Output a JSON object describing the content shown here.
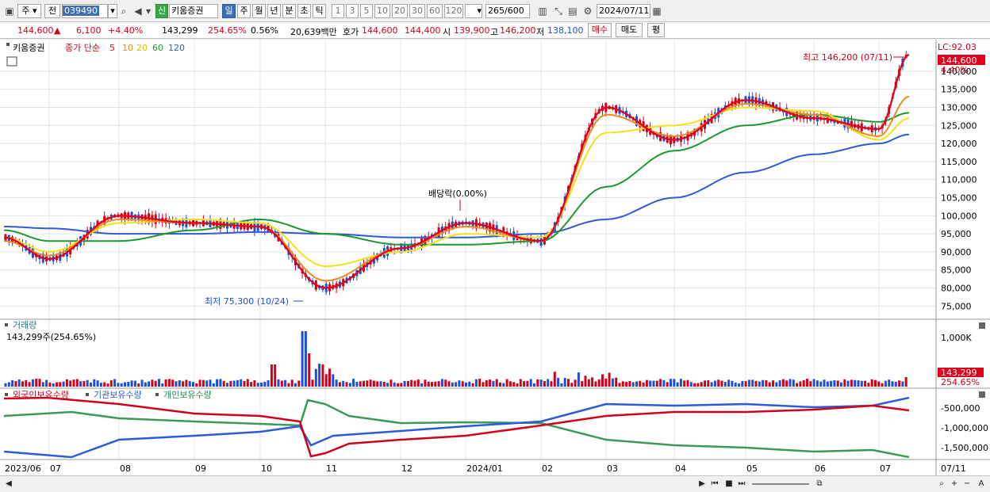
{
  "toolbar": {
    "market": "주",
    "market_all": "전",
    "code": "039490",
    "sin_badge": "신",
    "stock_name": "키움증권",
    "periods": [
      "일",
      "주",
      "월",
      "년",
      "분",
      "초",
      "틱"
    ],
    "active_period": "일",
    "intervals": [
      "1",
      "3",
      "5",
      "10",
      "20",
      "30",
      "60",
      "120"
    ],
    "count": "265",
    "count_total": "/600",
    "date": "2024/07/11"
  },
  "quote": {
    "price": "144,600",
    "direction": "▲",
    "change": "6,100",
    "change_pct": "+4.40%",
    "volume": "143,299",
    "volume_ratio": "254.65%",
    "turnover": "0.56%",
    "amount": "20,639백만",
    "ask_label": "호가",
    "ask": "144,600",
    "bid": "144,400",
    "open_label": "시",
    "open": "139,900",
    "high_label": "고",
    "high": "146,200",
    "low_label": "저",
    "low": "138,100",
    "buy_label": "매수",
    "sell_label": "매도",
    "eval_label": "평"
  },
  "legend": {
    "name": "키움증권",
    "ma_label": "종가 단순",
    "ma_periods": [
      "5",
      "10",
      "20",
      "60",
      "120"
    ]
  },
  "annotations": {
    "high_note": "최고 146,200 (07/11)",
    "low_note": "최저 75,300 (10/24)",
    "dividend_note": "배당락(0.00%)",
    "lc": "LC:92.03",
    "last_price": "144,600",
    "last_pct": "4.40%"
  },
  "volume_panel": {
    "title": "거래량",
    "info": "143,299주(254.65%)",
    "tick": "1,000K",
    "last_value": "143,299",
    "last_pct": "254.65%"
  },
  "holdings_panel": {
    "series_labels": [
      "외국인보유수량",
      "기관보유수량",
      "개인보유수량"
    ],
    "ticks": [
      "-500,000",
      "-1,000,000",
      "-1,500,000"
    ]
  },
  "xaxis": {
    "labels": [
      "2023/06",
      "07",
      "08",
      "09",
      "10",
      "11",
      "12",
      "2024/01",
      "02",
      "03",
      "04",
      "05",
      "06",
      "07"
    ],
    "right_label": "07/11"
  },
  "colors": {
    "up": "#d0021b",
    "down": "#1e4fd8",
    "ma5": "#e0001b",
    "ma10": "#f08a1c",
    "ma20": "#f2e21a",
    "ma60": "#1a9a2e",
    "ma120": "#2e5bd8",
    "foreign": "#d0021b",
    "institution": "#2e5bd8",
    "individual": "#3a9a5a"
  },
  "chart_data": {
    "type": "line",
    "title": "키움증권",
    "y_ticks": [
      75000,
      80000,
      85000,
      90000,
      95000,
      100000,
      105000,
      110000,
      115000,
      120000,
      125000,
      130000,
      135000,
      140000
    ],
    "ylim": [
      72000,
      147000
    ],
    "x": [
      "2023/06",
      "07",
      "08",
      "09",
      "10",
      "11",
      "12",
      "2024/01",
      "02",
      "03",
      "04",
      "05",
      "06",
      "07",
      "07/11"
    ],
    "series": [
      {
        "name": "5",
        "values": [
          94000,
          88000,
          100000,
          98000,
          97000,
          80000,
          91000,
          98000,
          93000,
          130000,
          121000,
          132000,
          127000,
          124000,
          144600
        ]
      },
      {
        "name": "10",
        "values": [
          93000,
          89000,
          99000,
          98000,
          97000,
          82000,
          91000,
          97000,
          93000,
          128000,
          122000,
          131000,
          128000,
          122000,
          133000
        ]
      },
      {
        "name": "20",
        "values": [
          94000,
          90000,
          98000,
          99000,
          98000,
          86000,
          90000,
          95000,
          94000,
          123000,
          125000,
          130000,
          129000,
          121000,
          127000
        ]
      },
      {
        "name": "60",
        "values": [
          96000,
          93000,
          93000,
          96000,
          99000,
          95000,
          92000,
          92000,
          93000,
          108000,
          118000,
          125000,
          128000,
          126000,
          128500
        ]
      },
      {
        "name": "120",
        "values": [
          97000,
          96500,
          95000,
          95000,
          95500,
          95000,
          94000,
          94000,
          95000,
          99000,
          105000,
          112000,
          117000,
          120000,
          122500
        ]
      }
    ]
  }
}
